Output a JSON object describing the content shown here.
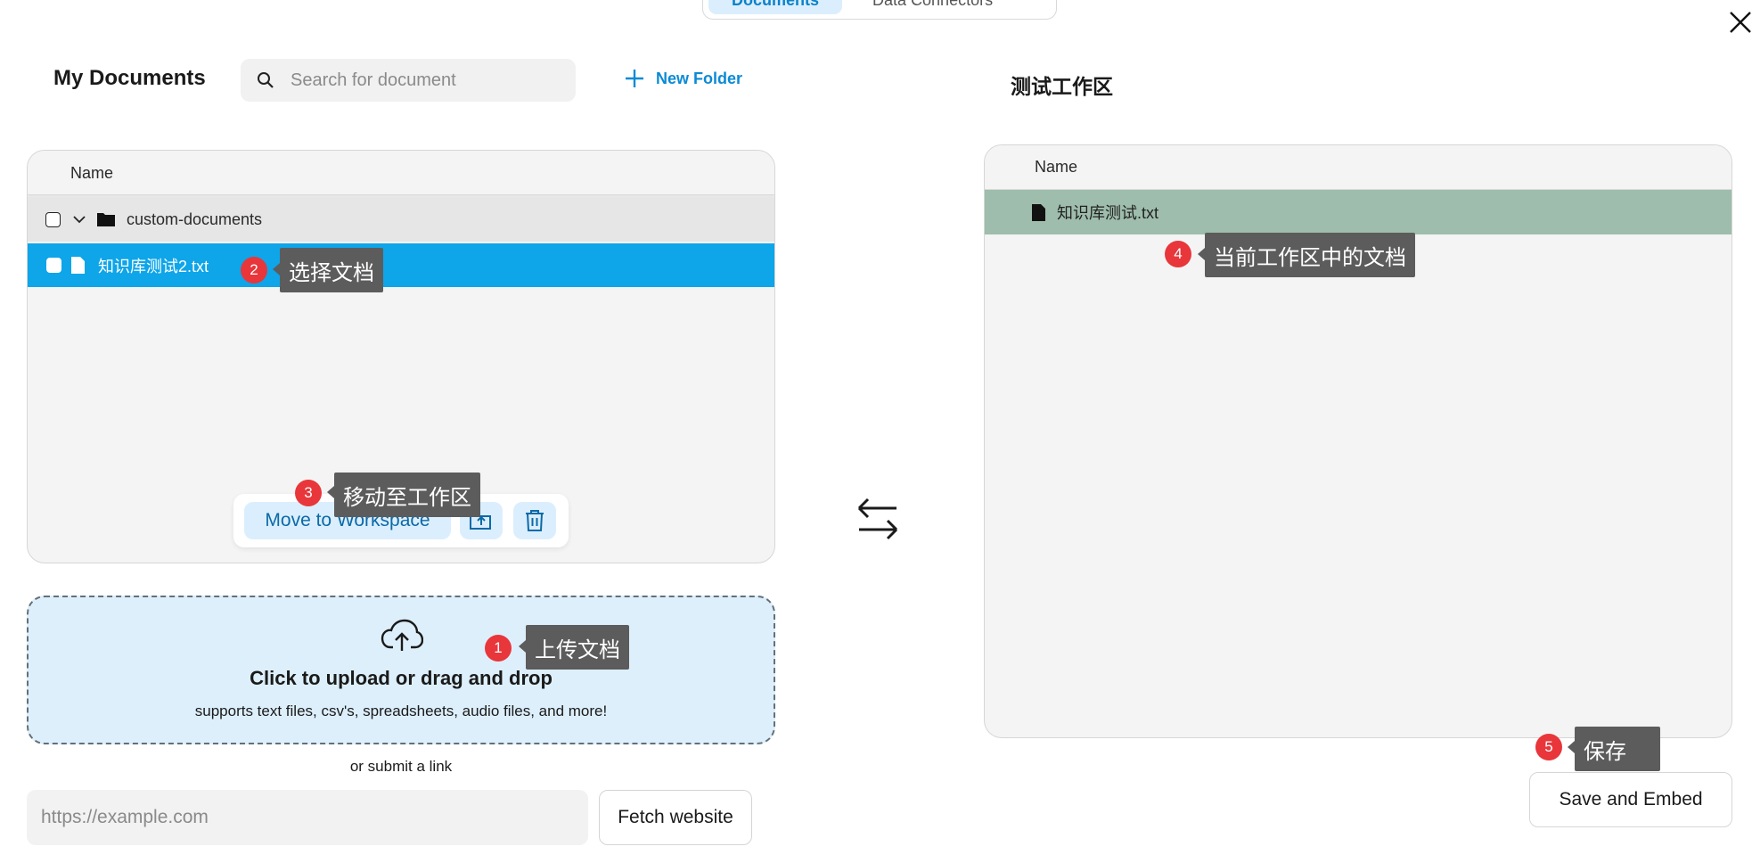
{
  "top_tabs": [
    "Documents",
    "Data Connectors"
  ],
  "left": {
    "title": "My Documents",
    "search_placeholder": "Search for document",
    "new_folder": "New Folder",
    "column_name": "Name",
    "folder": "custom-documents",
    "file": "知识库测试2.txt",
    "move_button": "Move to Workspace"
  },
  "upload": {
    "title": "Click to upload or drag and drop",
    "subtitle": "supports text files, csv's, spreadsheets, audio files, and more!",
    "or_link": "or submit a link",
    "url_placeholder": "https://example.com",
    "fetch_button": "Fetch website"
  },
  "right": {
    "title": "测试工作区",
    "column_name": "Name",
    "file": "知识库测试.txt",
    "save_button": "Save and Embed"
  },
  "annotations": {
    "a1": {
      "num": "1",
      "text": "上传文档"
    },
    "a2": {
      "num": "2",
      "text": "选择文档"
    },
    "a3": {
      "num": "3",
      "text": "移动至工作区"
    },
    "a4": {
      "num": "4",
      "text": "当前工作区中的文档"
    },
    "a5": {
      "num": "5",
      "text": "保存"
    }
  },
  "colors": {
    "accent": "#0ea5e9",
    "workspace_row": "#9ebdac",
    "annotation_badge": "#e8363b",
    "annotation_tooltip": "#5c5c5c"
  }
}
